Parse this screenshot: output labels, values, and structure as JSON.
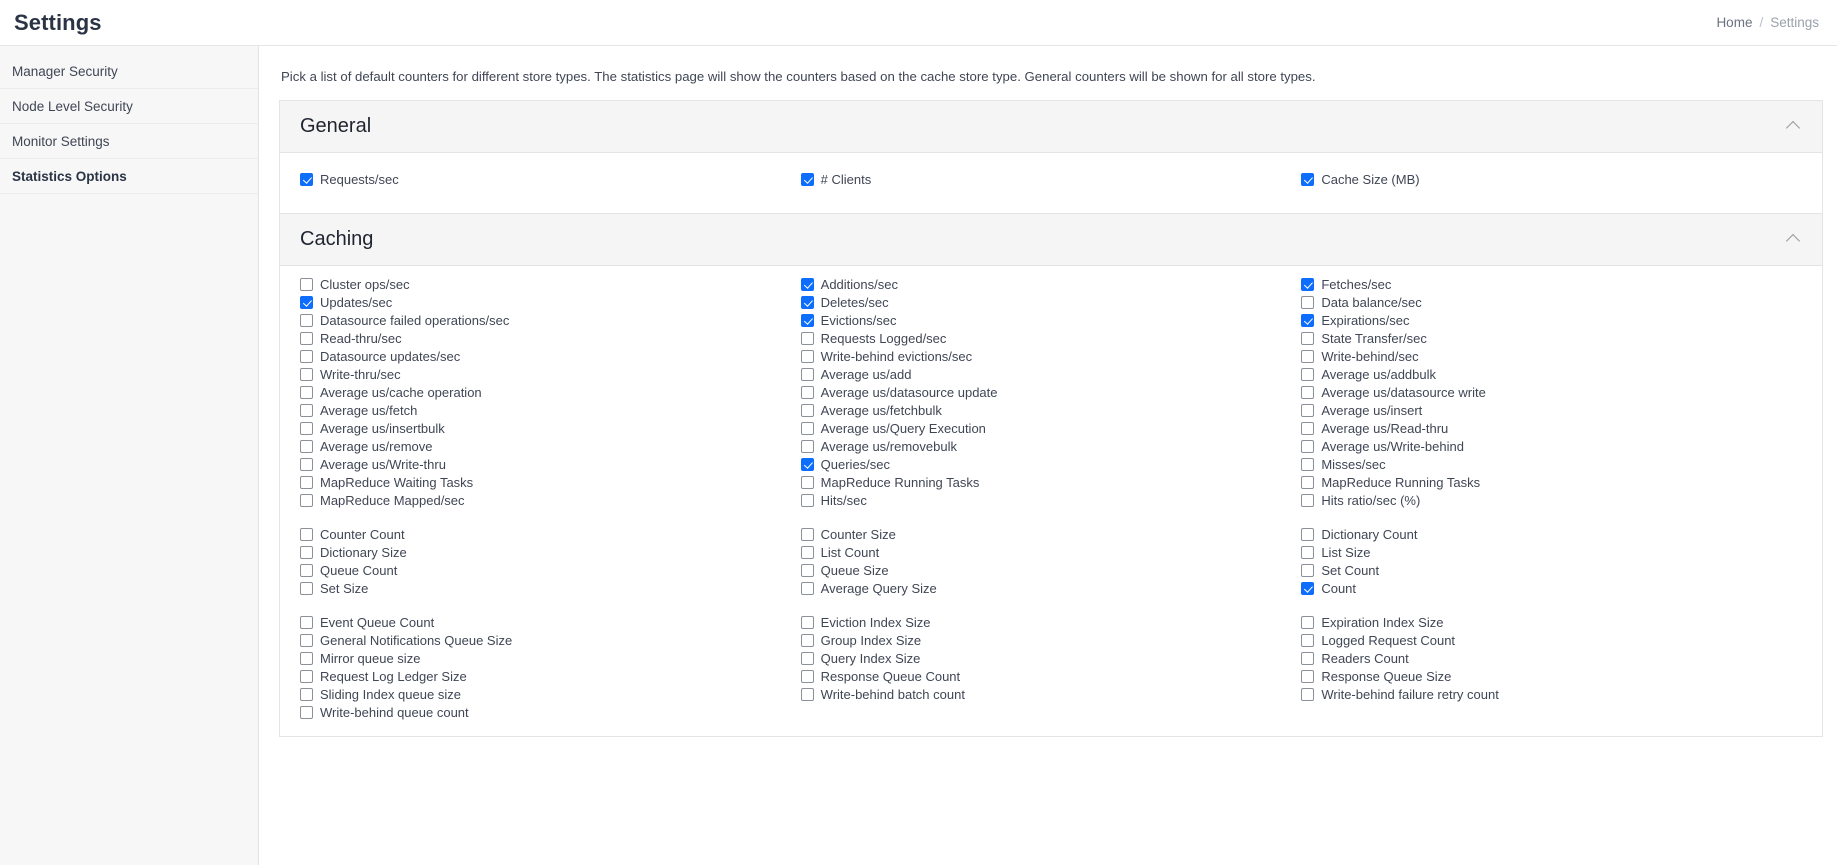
{
  "header": {
    "title": "Settings",
    "breadcrumb": {
      "home": "Home",
      "separator": "/",
      "current": "Settings"
    }
  },
  "sidebar": {
    "items": [
      {
        "label": "Manager Security",
        "active": false
      },
      {
        "label": "Node Level Security",
        "active": false
      },
      {
        "label": "Monitor Settings",
        "active": false
      },
      {
        "label": "Statistics Options",
        "active": true
      }
    ]
  },
  "main": {
    "intro": "Pick a list of default counters for different store types. The statistics page will show the counters based on the cache store type. General counters will be shown for all store types.",
    "sections": [
      {
        "title": "General",
        "collapse_icon": "chevron-up-icon",
        "expanded": true,
        "blocks": [
          {
            "columns": [
              [
                {
                  "label": "Requests/sec",
                  "checked": true
                }
              ],
              [
                {
                  "label": "# Clients",
                  "checked": true
                }
              ],
              [
                {
                  "label": "Cache Size (MB)",
                  "checked": true
                }
              ]
            ]
          }
        ]
      },
      {
        "title": "Caching",
        "collapse_icon": "chevron-up-icon",
        "expanded": true,
        "blocks": [
          {
            "columns": [
              [
                {
                  "label": "Cluster ops/sec",
                  "checked": false
                },
                {
                  "label": "Updates/sec",
                  "checked": true
                },
                {
                  "label": "Datasource failed operations/sec",
                  "checked": false
                },
                {
                  "label": "Read-thru/sec",
                  "checked": false
                },
                {
                  "label": "Datasource updates/sec",
                  "checked": false
                },
                {
                  "label": "Write-thru/sec",
                  "checked": false
                },
                {
                  "label": "Average us/cache operation",
                  "checked": false
                },
                {
                  "label": "Average us/fetch",
                  "checked": false
                },
                {
                  "label": "Average us/insertbulk",
                  "checked": false
                },
                {
                  "label": "Average us/remove",
                  "checked": false
                },
                {
                  "label": "Average us/Write-thru",
                  "checked": false
                },
                {
                  "label": "MapReduce Waiting Tasks",
                  "checked": false
                },
                {
                  "label": "MapReduce Mapped/sec",
                  "checked": false
                }
              ],
              [
                {
                  "label": "Additions/sec",
                  "checked": true
                },
                {
                  "label": "Deletes/sec",
                  "checked": true
                },
                {
                  "label": "Evictions/sec",
                  "checked": true
                },
                {
                  "label": "Requests Logged/sec",
                  "checked": false
                },
                {
                  "label": "Write-behind evictions/sec",
                  "checked": false
                },
                {
                  "label": "Average us/add",
                  "checked": false
                },
                {
                  "label": "Average us/datasource update",
                  "checked": false
                },
                {
                  "label": "Average us/fetchbulk",
                  "checked": false
                },
                {
                  "label": "Average us/Query Execution",
                  "checked": false
                },
                {
                  "label": "Average us/removebulk",
                  "checked": false
                },
                {
                  "label": "Queries/sec",
                  "checked": true
                },
                {
                  "label": "MapReduce Running Tasks",
                  "checked": false
                },
                {
                  "label": "Hits/sec",
                  "checked": false
                }
              ],
              [
                {
                  "label": "Fetches/sec",
                  "checked": true
                },
                {
                  "label": "Data balance/sec",
                  "checked": false
                },
                {
                  "label": "Expirations/sec",
                  "checked": true
                },
                {
                  "label": "State Transfer/sec",
                  "checked": false
                },
                {
                  "label": "Write-behind/sec",
                  "checked": false
                },
                {
                  "label": "Average us/addbulk",
                  "checked": false
                },
                {
                  "label": "Average us/datasource write",
                  "checked": false
                },
                {
                  "label": "Average us/insert",
                  "checked": false
                },
                {
                  "label": "Average us/Read-thru",
                  "checked": false
                },
                {
                  "label": "Average us/Write-behind",
                  "checked": false
                },
                {
                  "label": "Misses/sec",
                  "checked": false
                },
                {
                  "label": "MapReduce Running Tasks",
                  "checked": false
                },
                {
                  "label": "Hits ratio/sec (%)",
                  "checked": false
                }
              ]
            ]
          },
          {
            "columns": [
              [
                {
                  "label": "Counter Count",
                  "checked": false
                },
                {
                  "label": "Dictionary Size",
                  "checked": false
                },
                {
                  "label": "Queue Count",
                  "checked": false
                },
                {
                  "label": "Set Size",
                  "checked": false
                }
              ],
              [
                {
                  "label": "Counter Size",
                  "checked": false
                },
                {
                  "label": "List Count",
                  "checked": false
                },
                {
                  "label": "Queue Size",
                  "checked": false
                },
                {
                  "label": "Average Query Size",
                  "checked": false
                }
              ],
              [
                {
                  "label": "Dictionary Count",
                  "checked": false
                },
                {
                  "label": "List Size",
                  "checked": false
                },
                {
                  "label": "Set Count",
                  "checked": false
                },
                {
                  "label": "Count",
                  "checked": true
                }
              ]
            ]
          },
          {
            "columns": [
              [
                {
                  "label": "Event Queue Count",
                  "checked": false
                },
                {
                  "label": "General Notifications Queue Size",
                  "checked": false
                },
                {
                  "label": "Mirror queue size",
                  "checked": false
                },
                {
                  "label": "Request Log Ledger Size",
                  "checked": false
                },
                {
                  "label": "Sliding Index queue size",
                  "checked": false
                },
                {
                  "label": "Write-behind queue count",
                  "checked": false
                }
              ],
              [
                {
                  "label": "Eviction Index Size",
                  "checked": false
                },
                {
                  "label": "Group Index Size",
                  "checked": false
                },
                {
                  "label": "Query Index Size",
                  "checked": false
                },
                {
                  "label": "Response Queue Count",
                  "checked": false
                },
                {
                  "label": "Write-behind batch count",
                  "checked": false
                }
              ],
              [
                {
                  "label": "Expiration Index Size",
                  "checked": false
                },
                {
                  "label": "Logged Request Count",
                  "checked": false
                },
                {
                  "label": "Readers Count",
                  "checked": false
                },
                {
                  "label": "Response Queue Size",
                  "checked": false
                },
                {
                  "label": "Write-behind failure retry count",
                  "checked": false
                }
              ]
            ]
          }
        ]
      }
    ]
  },
  "colors": {
    "accent": "#0d6efd",
    "panel_header_bg": "#f5f5f5",
    "sidebar_bg": "#f7f7f7",
    "border": "#e4e4e4",
    "text": "#3f4654"
  }
}
